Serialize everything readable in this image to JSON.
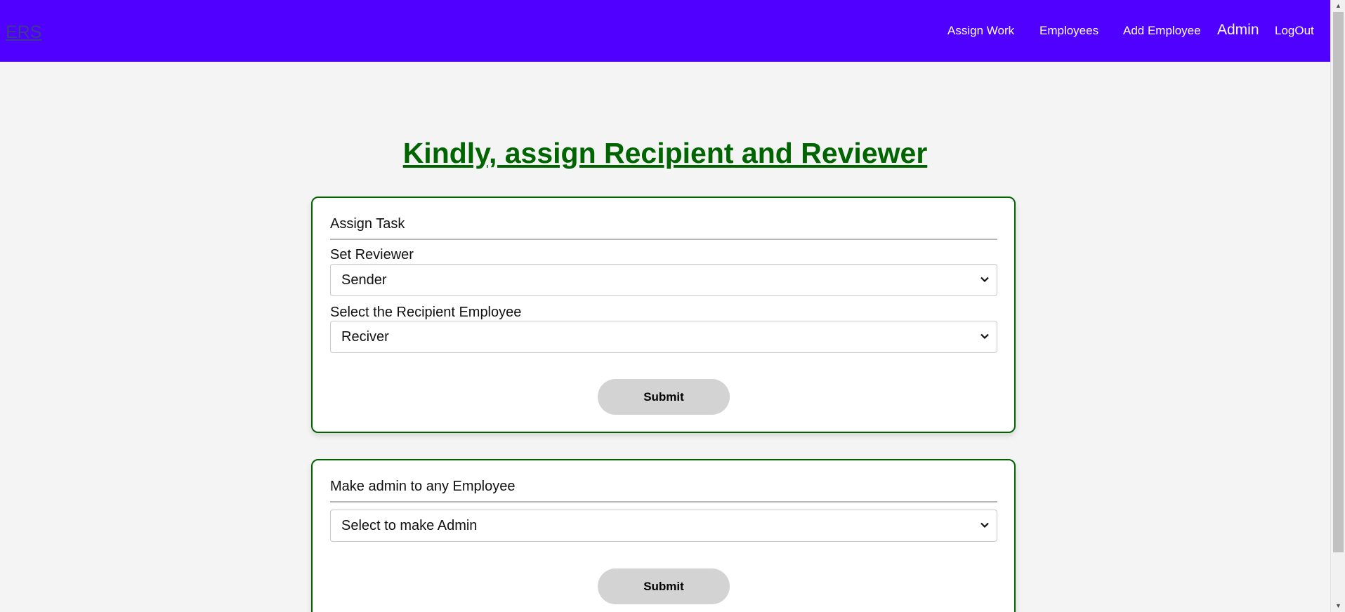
{
  "navbar": {
    "brand": "ERS",
    "links": {
      "assign_work": "Assign Work",
      "employees": "Employees",
      "add_employee": "Add Employee",
      "admin": "Admin",
      "logout": "LogOut"
    },
    "background": "#4f00ff"
  },
  "main": {
    "title": "Kindly, assign Recipient and Reviewer",
    "title_color": "#006400"
  },
  "assign_task_card": {
    "title": "Assign Task",
    "reviewer_label": "Set Reviewer",
    "reviewer_selected": "Sender",
    "recipient_label": "Select the Recipient Employee",
    "recipient_selected": "Reciver",
    "submit_label": "Submit"
  },
  "make_admin_card": {
    "title": "Make admin to any Employee",
    "select_selected": "Select to make Admin",
    "submit_label": "Submit"
  },
  "icons": {
    "dropdown": "chevron-down-icon",
    "scroll_up": "scroll-up-arrow-icon",
    "scroll_down": "scroll-down-arrow-icon"
  }
}
